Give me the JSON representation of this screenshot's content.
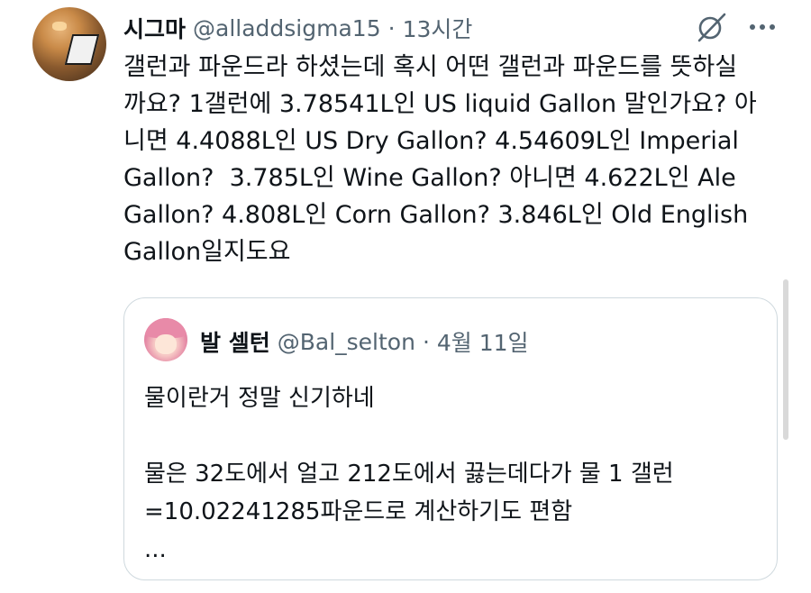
{
  "tweet": {
    "display_name": "시그마",
    "handle": "@alladdsigma15",
    "separator": "·",
    "time": "13시간",
    "text": "갤런과 파운드라 하셨는데 혹시 어떤 갤런과 파운드를 뜻하실\n까요? 1갤런에 3.78541L인 US liquid Gallon 말인가요? 아\n니면 4.4088L인 US Dry Gallon? 4.54609L인 Imperial\nGallon?  3.785L인 Wine Gallon? 아니면 4.622L인 Ale\nGallon? 4.808L인 Corn Gallon? 3.846L인 Old English\nGallon일지도요",
    "icons": {
      "avatar": "avatar",
      "grok": "grok-icon",
      "more": "more-icon"
    }
  },
  "quote": {
    "display_name": "발 셀턴",
    "handle": "@Bal_selton",
    "separator": "·",
    "time": "4월 11일",
    "text": "물이란거 정말 신기하네\n\n물은 32도에서 얼고 212도에서 끓는데다가 물 1 갤런\n=10.02241285파운드로 계산하기도 편함\n..."
  },
  "colors": {
    "text_primary": "#0f1419",
    "text_secondary": "#536471",
    "border": "#cfd9de"
  }
}
